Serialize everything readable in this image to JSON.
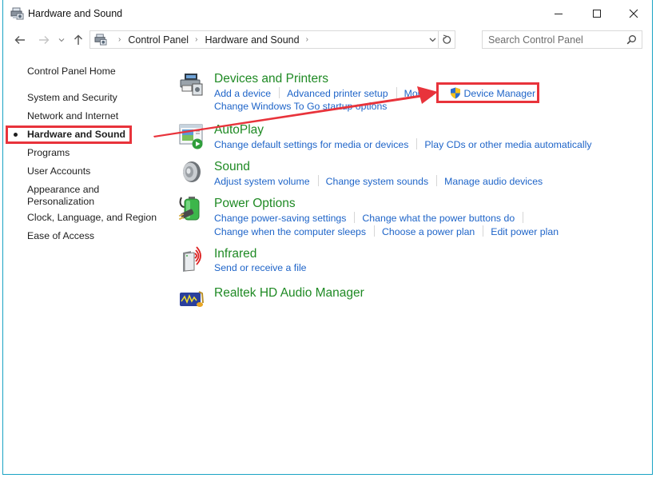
{
  "window": {
    "title": "Hardware and Sound",
    "title_icon": "hardware-sound-icon",
    "controls": {
      "minimize": "minimize-icon",
      "maximize": "maximize-icon",
      "close": "close-icon"
    }
  },
  "navigation": {
    "back_icon": "arrow-left-icon",
    "forward_icon": "arrow-right-icon",
    "recent_icon": "chevron-down-icon",
    "up_icon": "arrow-up-icon",
    "breadcrumb": [
      "Control Panel",
      "Hardware and Sound"
    ],
    "search_placeholder": "Search Control Panel"
  },
  "sidebar": {
    "items": [
      {
        "label": "Control Panel Home",
        "active": false
      },
      {
        "label": "System and Security",
        "active": false
      },
      {
        "label": "Network and Internet",
        "active": false
      },
      {
        "label": "Hardware and Sound",
        "active": true
      },
      {
        "label": "Programs",
        "active": false
      },
      {
        "label": "User Accounts",
        "active": false
      },
      {
        "label": "Appearance and\nPersonalization",
        "line1": "Appearance and",
        "line2": "Personalization",
        "active": false
      },
      {
        "label": "Clock, Language, and Region",
        "active": false
      },
      {
        "label": "Ease of Access",
        "active": false
      }
    ]
  },
  "categories": [
    {
      "title": "Devices and Printers",
      "icon": "printer-icon",
      "links": [
        [
          "Add a device",
          "Advanced printer setup",
          "Mouse",
          "Device Manager"
        ],
        [
          "Change Windows To Go startup options"
        ]
      ]
    },
    {
      "title": "AutoPlay",
      "icon": "autoplay-icon",
      "links": [
        [
          "Change default settings for media or devices",
          "Play CDs or other media automatically"
        ]
      ]
    },
    {
      "title": "Sound",
      "icon": "speaker-icon",
      "links": [
        [
          "Adjust system volume",
          "Change system sounds",
          "Manage audio devices"
        ]
      ]
    },
    {
      "title": "Power Options",
      "icon": "battery-plug-icon",
      "links": [
        [
          "Change power-saving settings",
          "Change what the power buttons do"
        ],
        [
          "Change when the computer sleeps",
          "Choose a power plan",
          "Edit power plan"
        ]
      ]
    },
    {
      "title": "Infrared",
      "icon": "infrared-icon",
      "links": [
        [
          "Send or receive a file"
        ]
      ]
    },
    {
      "title": "Realtek HD Audio Manager",
      "icon": "realtek-audio-icon",
      "links": []
    }
  ],
  "annotations": {
    "highlight_color": "#e8333b",
    "highlighted": [
      "Hardware and Sound",
      "Device Manager"
    ]
  },
  "colors": {
    "category_title": "#1f8a24",
    "link": "#1e64c8",
    "window_border": "#1aa3c4"
  }
}
